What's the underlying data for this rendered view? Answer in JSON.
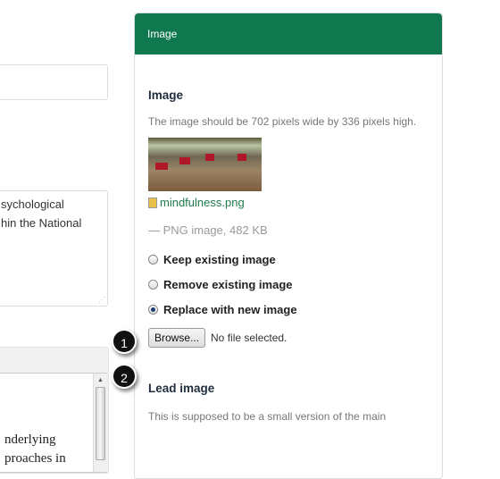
{
  "left": {
    "textarea_lines": [
      "sychological",
      "hin the National"
    ],
    "editor_lines": [
      "nderlying",
      "proaches in"
    ]
  },
  "panel": {
    "header": "Image",
    "image_heading": "Image",
    "description": "The image should be 702 pixels wide by 336 pixels high.",
    "file_name": "mindfulness.png",
    "file_info": "— PNG image, 482 KB",
    "options": [
      "Keep existing image",
      "Remove existing image",
      "Replace with new image"
    ],
    "selected_option": "Replace with new image",
    "browse_label": "Browse...",
    "no_file": "No file selected.",
    "lead_heading": "Lead image",
    "lead_description": "This is supposed to be a small version of the main"
  },
  "callouts": [
    "1",
    "2"
  ],
  "colors": {
    "header": "#10784f",
    "link": "#1f7a4a"
  }
}
